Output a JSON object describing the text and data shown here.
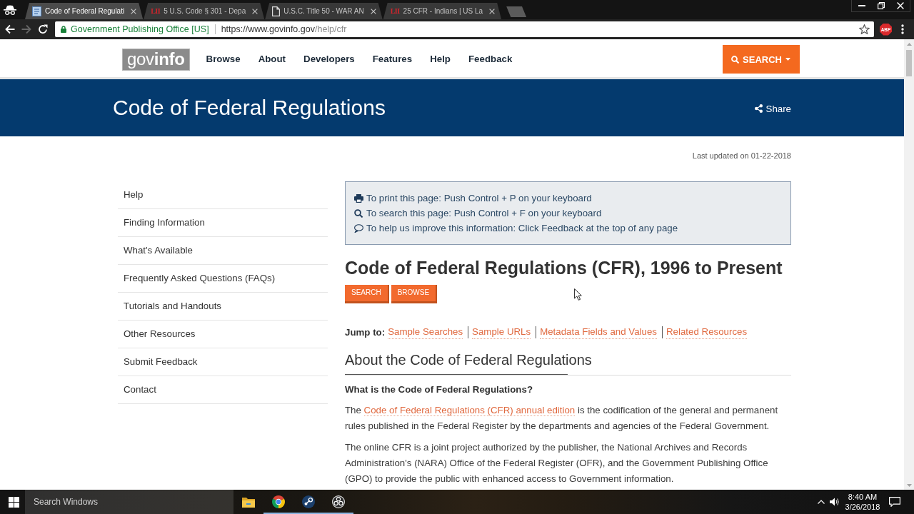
{
  "browser": {
    "tabs": [
      {
        "kind": "site-icon",
        "title": "Code of Federal Regulati",
        "selected": true
      },
      {
        "kind": "text-icon",
        "icon_text": "LII",
        "title": "5 U.S. Code § 301 - Depa",
        "selected": false
      },
      {
        "kind": "page-icon",
        "title": "U.S.C. Title 50 - WAR AN",
        "selected": false
      },
      {
        "kind": "text-icon",
        "icon_text": "LII",
        "title": "25 CFR - Indians | US La",
        "selected": false
      }
    ],
    "forward_disabled": true,
    "address": {
      "site_name": "Government Publishing Office [US]",
      "url_origin": "https://www.govinfo.gov",
      "url_path": "/help/cfr"
    },
    "extension_label": "ABP"
  },
  "site_header": {
    "logo": "gov**info**",
    "nav": [
      "Browse",
      "About",
      "Developers",
      "Features",
      "Help",
      "Feedback"
    ],
    "search_button": "SEARCH"
  },
  "banner": {
    "title": "Code of Federal Regulations",
    "share": "Share"
  },
  "last_updated": "Last updated on 01-22-2018",
  "sidebar": {
    "items": [
      "Help",
      "Finding Information",
      "What's Available",
      "Frequently Asked Questions (FAQs)",
      "Tutorials and Handouts",
      "Other Resources",
      "Submit Feedback",
      "Contact"
    ]
  },
  "notice": {
    "lines": [
      {
        "kind": "print",
        "text": "To print this page: Push Control + P on your keyboard"
      },
      {
        "kind": "search",
        "text": "To search this page: Push Control + F on your keyboard"
      },
      {
        "kind": "comment",
        "text": "To help us improve this information: Click Feedback at the top of any page"
      }
    ]
  },
  "main": {
    "title": "Code of Federal Regulations (CFR), 1996 to Present",
    "buttons": [
      "SEARCH",
      "BROWSE"
    ],
    "jump_to": {
      "label": "Jump to:",
      "links": [
        "Sample Searches",
        "Sample URLs",
        "Metadata Fields and Values",
        "Related Resources"
      ]
    },
    "section_title": "About the Code of Federal Regulations",
    "question": "What is the Code of Federal Regulations?",
    "paragraphs": [
      {
        "kind": "linked",
        "before": "The ",
        "link": "Code of Federal Regulations (CFR) annual edition",
        "after": " is the codification of the general and permanent rules published in the Federal Register by the departments and agencies of the Federal Government."
      },
      {
        "kind": "plain",
        "text": "The online CFR is a joint project authorized by the publisher, the National Archives and Records Administration's (NARA) Office of the Federal Register (OFR), and the Government Publishing Office (GPO) to provide the public with enhanced access to Government information."
      }
    ]
  },
  "taskbar": {
    "search": {
      "placeholder": "Search Windows"
    },
    "apps": [
      {
        "kind": "folder",
        "running": false
      },
      {
        "kind": "ring",
        "running": true
      },
      {
        "kind": "disc",
        "running": true
      },
      {
        "kind": "aperture",
        "running": true
      }
    ],
    "time": "8:40 AM",
    "date": "3/26/2018"
  }
}
